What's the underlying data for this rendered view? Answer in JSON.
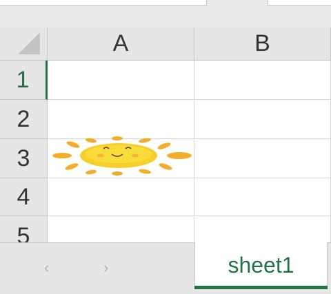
{
  "columns": [
    "A",
    "B"
  ],
  "rows": [
    "1",
    "2",
    "3",
    "4",
    "5"
  ],
  "selected_row": "1",
  "cell_A3": "sun-image",
  "sheet_tab": "sheet1",
  "nav": {
    "prev": "‹",
    "next": "›"
  },
  "colors": {
    "accent": "#217346",
    "header_bg": "#e6e6e6",
    "grid": "#d4d4d4"
  }
}
